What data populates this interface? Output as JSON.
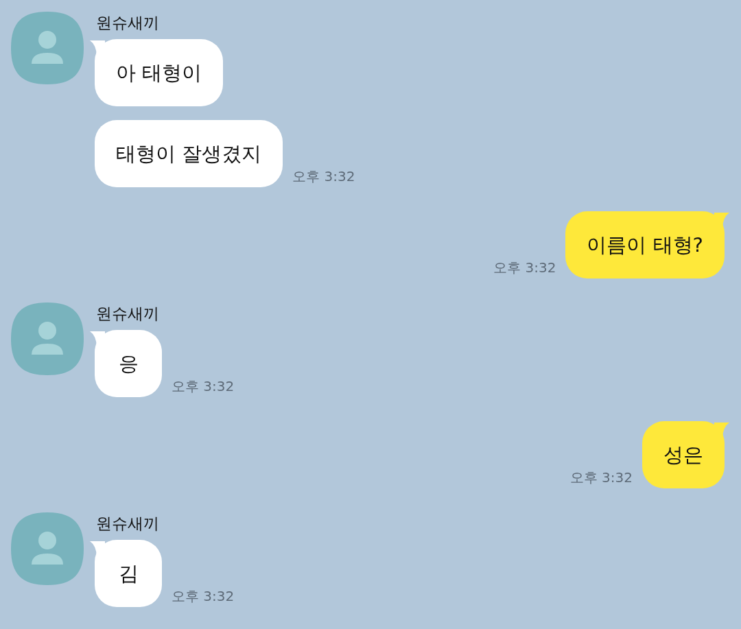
{
  "messages": [
    {
      "kind": "incoming",
      "sender": "원슈새끼",
      "bubbles": [
        {
          "text": "아 태형이"
        },
        {
          "text": "태형이 잘생겼지",
          "time": "오후 3:32"
        }
      ]
    },
    {
      "kind": "outgoing",
      "bubbles": [
        {
          "text": "이름이 태형?",
          "time": "오후 3:32"
        }
      ]
    },
    {
      "kind": "incoming",
      "sender": "원슈새끼",
      "bubbles": [
        {
          "text": "응",
          "time": "오후 3:32"
        }
      ]
    },
    {
      "kind": "outgoing",
      "bubbles": [
        {
          "text": "성은",
          "time": "오후 3:32"
        }
      ]
    },
    {
      "kind": "incoming",
      "sender": "원슈새끼",
      "bubbles": [
        {
          "text": "김",
          "time": "오후 3:32"
        }
      ]
    }
  ]
}
